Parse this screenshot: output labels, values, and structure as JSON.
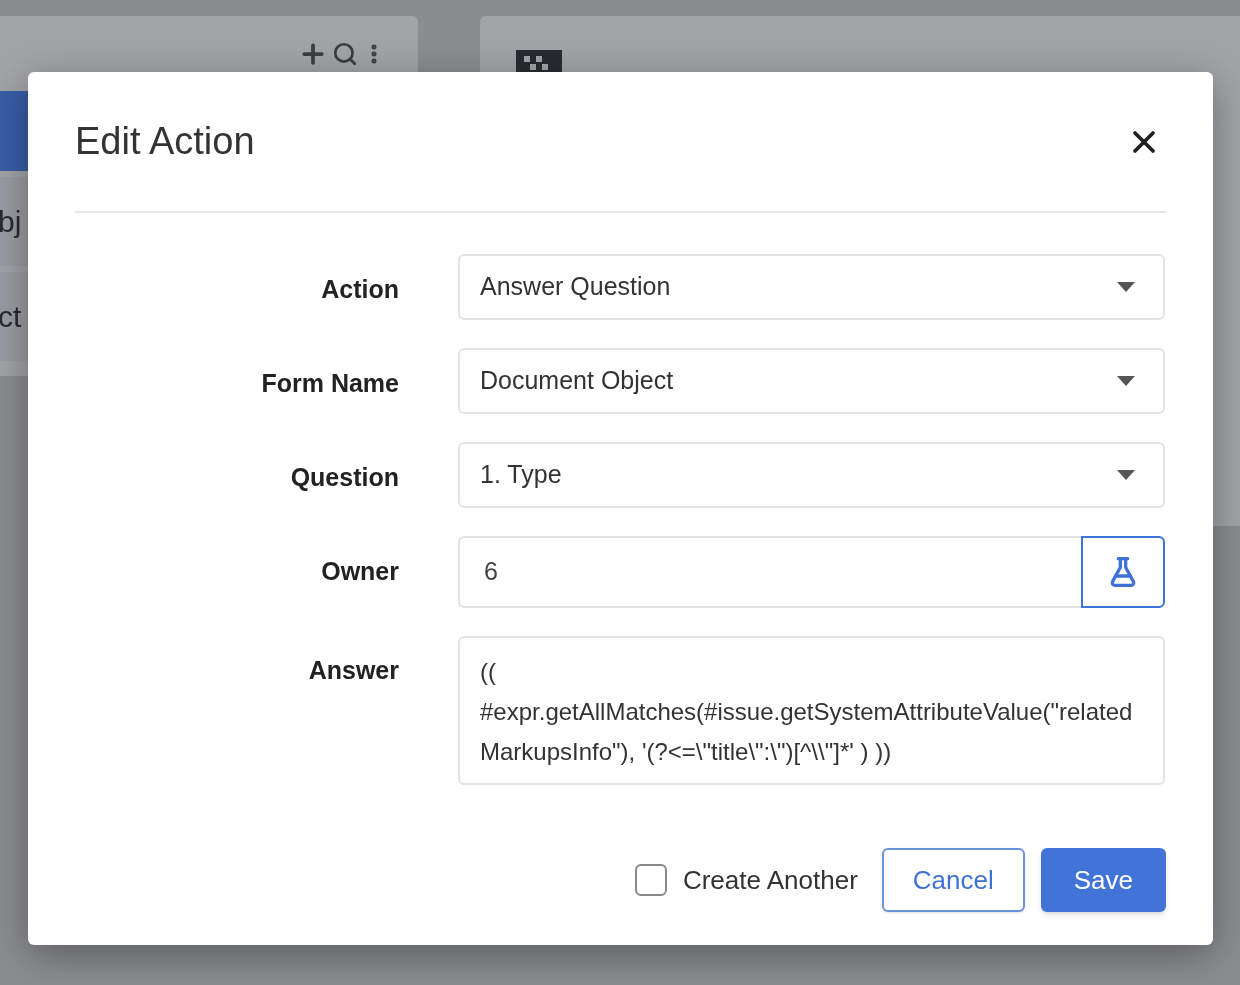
{
  "background": {
    "left_panel": {
      "rows": [
        {
          "selected": true
        },
        {
          "text": "bj",
          "selected": false
        },
        {
          "text": "ct",
          "selected": false
        }
      ]
    }
  },
  "dialog": {
    "title": "Edit Action",
    "fields": [
      {
        "label": "Action",
        "kind": "select",
        "value": "Answer Question"
      },
      {
        "label": "Form Name",
        "kind": "select",
        "value": "Document Object"
      },
      {
        "label": "Question",
        "kind": "select",
        "value": "1. Type"
      },
      {
        "label": "Owner",
        "kind": "input_button",
        "value": "6"
      },
      {
        "label": "Answer",
        "kind": "textarea",
        "value": "(( #expr.getAllMatches(#issue.getSystemAttributeValue(\"relatedMarkupsInfo\"), '(?<=\\\"title\\\":\\\")[^\\\\\"]*' ) ))"
      }
    ],
    "create_another": {
      "label": "Create Another",
      "checked": false
    },
    "buttons": [
      {
        "label": "Cancel",
        "kind": "secondary"
      },
      {
        "label": "Save",
        "kind": "primary"
      }
    ]
  }
}
